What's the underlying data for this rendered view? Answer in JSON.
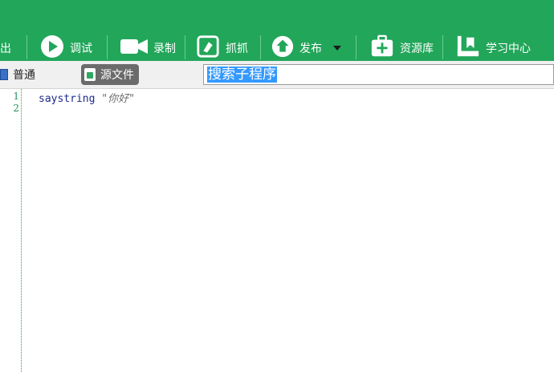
{
  "toolbar": {
    "items": [
      {
        "label": "出",
        "icon": "export-icon"
      },
      {
        "label": "调试",
        "icon": "play-icon"
      },
      {
        "label": "录制",
        "icon": "video-camera-icon"
      },
      {
        "label": "抓抓",
        "icon": "grab-icon"
      },
      {
        "label": "发布",
        "icon": "publish-icon"
      },
      {
        "label": "资源库",
        "icon": "resource-box-icon"
      },
      {
        "label": "学习中心",
        "icon": "learning-flag-icon"
      }
    ],
    "bg_color": "#22a65a"
  },
  "view_tabs": {
    "normal": "普通",
    "source": "源文件"
  },
  "search": {
    "value": "搜索子程序"
  },
  "editor": {
    "line_numbers": [
      "1",
      "2"
    ],
    "code": {
      "keyword": "saystring",
      "argument": "\"你好\""
    }
  }
}
